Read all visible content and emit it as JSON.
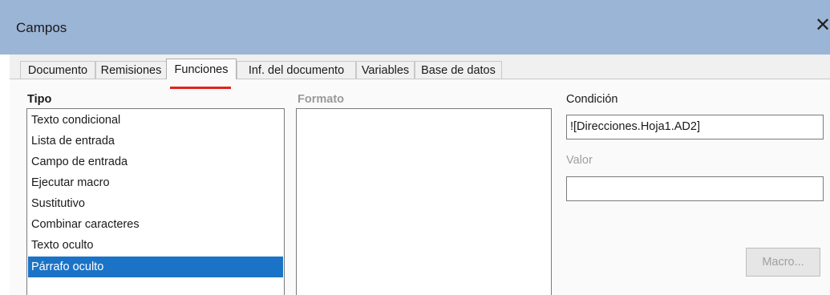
{
  "window": {
    "title": "Campos",
    "close_symbol": "✕"
  },
  "tabs": [
    {
      "label": "Documento",
      "active": false
    },
    {
      "label": "Remisiones",
      "active": false
    },
    {
      "label": "Funciones",
      "active": true
    },
    {
      "label": "Inf. del documento",
      "active": false
    },
    {
      "label": "Variables",
      "active": false
    },
    {
      "label": "Base de datos",
      "active": false
    }
  ],
  "tipo": {
    "label": "Tipo",
    "items": [
      "Texto condicional",
      "Lista de entrada",
      "Campo de entrada",
      "Ejecutar macro",
      "Sustitutivo",
      "Combinar caracteres",
      "Texto oculto",
      "Párrafo oculto"
    ],
    "selected": "Párrafo oculto"
  },
  "formato": {
    "label": "Formato"
  },
  "condicion": {
    "label": "Condición",
    "value": "![Direcciones.Hoja1.AD2]"
  },
  "valor": {
    "label": "Valor",
    "value": ""
  },
  "macro_button": {
    "label": "Macro..."
  },
  "colors": {
    "titlebar": "#9bb5d6",
    "selection": "#1a73c7",
    "active_tab_underline": "#e0231e"
  }
}
